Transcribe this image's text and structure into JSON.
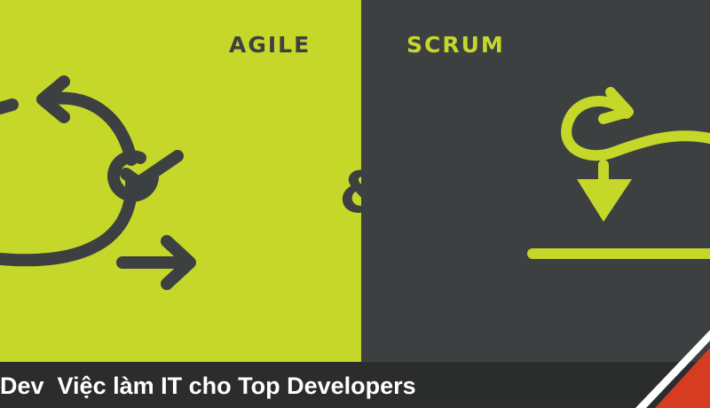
{
  "colors": {
    "lime": "#c5d82a",
    "charcoal": "#3d4040",
    "footer_bg": "#2b2d2d",
    "accent_red": "#d63c22",
    "white": "#ffffff"
  },
  "left_panel": {
    "heading": "AGILE",
    "icon": "agile-cycle-icon"
  },
  "right_panel": {
    "heading": "SCRUM",
    "icon": "scrum-loop-icon"
  },
  "ampersand": "&",
  "footer": {
    "text": "Dev  Việc làm IT cho Top Developers"
  }
}
